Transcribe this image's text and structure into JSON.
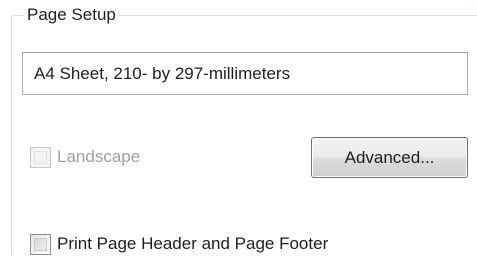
{
  "page_setup": {
    "group_title": "Page Setup",
    "paper_description": "A4 Sheet, 210- by 297-millimeters",
    "landscape": {
      "label": "Landscape",
      "checked": false,
      "enabled": false
    },
    "advanced_button_label": "Advanced...",
    "print_header_footer": {
      "label": "Print Page Header and Page Footer",
      "checked": false,
      "enabled": true
    }
  }
}
